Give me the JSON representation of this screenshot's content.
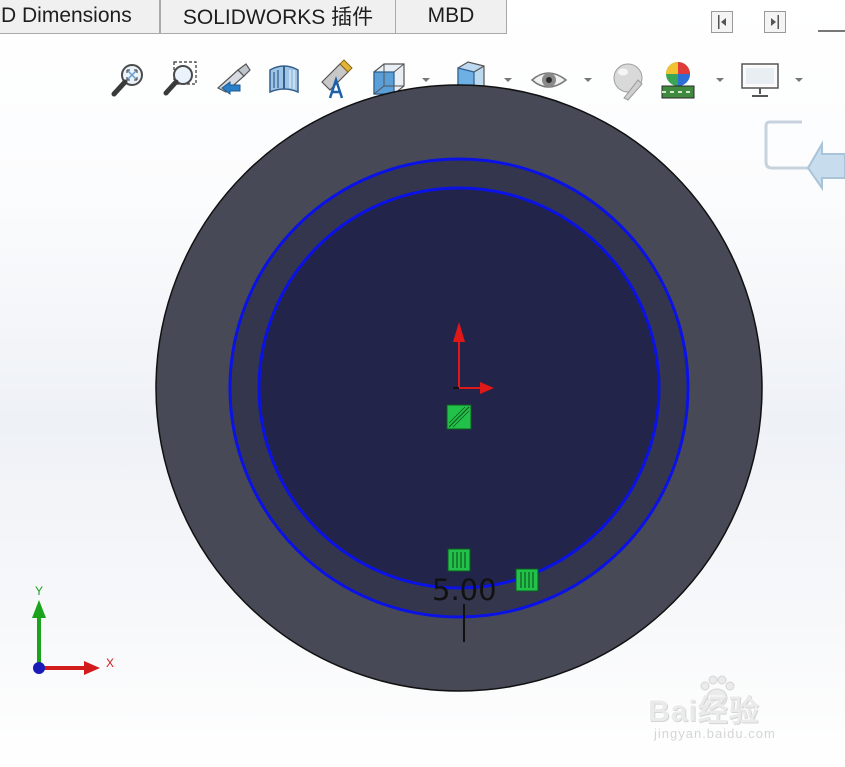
{
  "tabs": [
    {
      "label": "D Dimensions"
    },
    {
      "label": "SOLIDWORKS 插件"
    },
    {
      "label": "MBD"
    }
  ],
  "toolbar": {
    "icons": [
      "zoom-to-fit-icon",
      "zoom-to-area-icon",
      "previous-view-icon",
      "section-view-icon",
      "dynamic-annotation-views-icon",
      "view-orientation-icon",
      "display-style-icon",
      "hide-show-items-icon",
      "edit-appearance-icon",
      "apply-scene-icon",
      "view-settings-icon"
    ]
  },
  "sketch": {
    "dimension_value": "5.00"
  },
  "triad": {
    "x_label": "X",
    "y_label": "Y"
  },
  "watermark": {
    "main": "Bai经验",
    "sub": "jingyan.baidu.com"
  },
  "colors": {
    "outer_disc": "#474a56",
    "inner_disc": "#22244a",
    "sketch_circle": "#0b12e6",
    "relation_marker": "#22c24a",
    "origin_x": "#e01818",
    "origin_y": "#e01818",
    "triad_x": "#d21c1c",
    "triad_y": "#1ca31c",
    "triad_origin": "#1a1ab8"
  }
}
